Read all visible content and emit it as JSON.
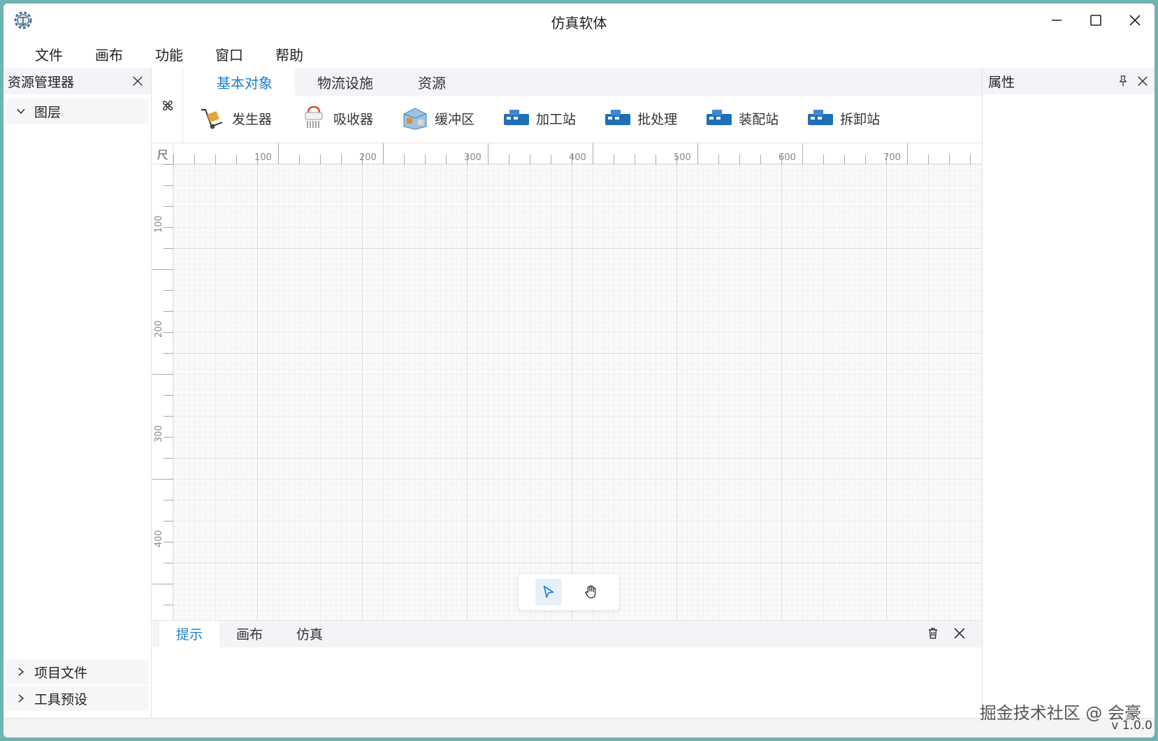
{
  "window": {
    "title": "仿真软体"
  },
  "menubar": {
    "items": [
      "文件",
      "画布",
      "功能",
      "窗口",
      "帮助"
    ]
  },
  "explorer": {
    "title": "资源管理器",
    "layer_label": "图层",
    "project_files_label": "项目文件",
    "tool_presets_label": "工具预设"
  },
  "properties": {
    "title": "属性"
  },
  "toolbar": {
    "tabs": [
      "基本对象",
      "物流设施",
      "资源"
    ],
    "objects": [
      "发生器",
      "吸收器",
      "缓冲区",
      "加工站",
      "批处理",
      "装配站",
      "拆卸站"
    ]
  },
  "ruler": {
    "corner": "尺",
    "h_labels": [
      "100",
      "200",
      "300",
      "400",
      "500",
      "600",
      "700"
    ],
    "v_labels": [
      "100",
      "200",
      "300",
      "400"
    ]
  },
  "console": {
    "tabs": [
      "提示",
      "画布",
      "仿真"
    ]
  },
  "footer": {
    "watermark": "掘金技术社区 @ 会豪",
    "version": "v 1.0.0"
  },
  "colors": {
    "accent": "#1e7fd2",
    "background": "#6fb3b3"
  }
}
